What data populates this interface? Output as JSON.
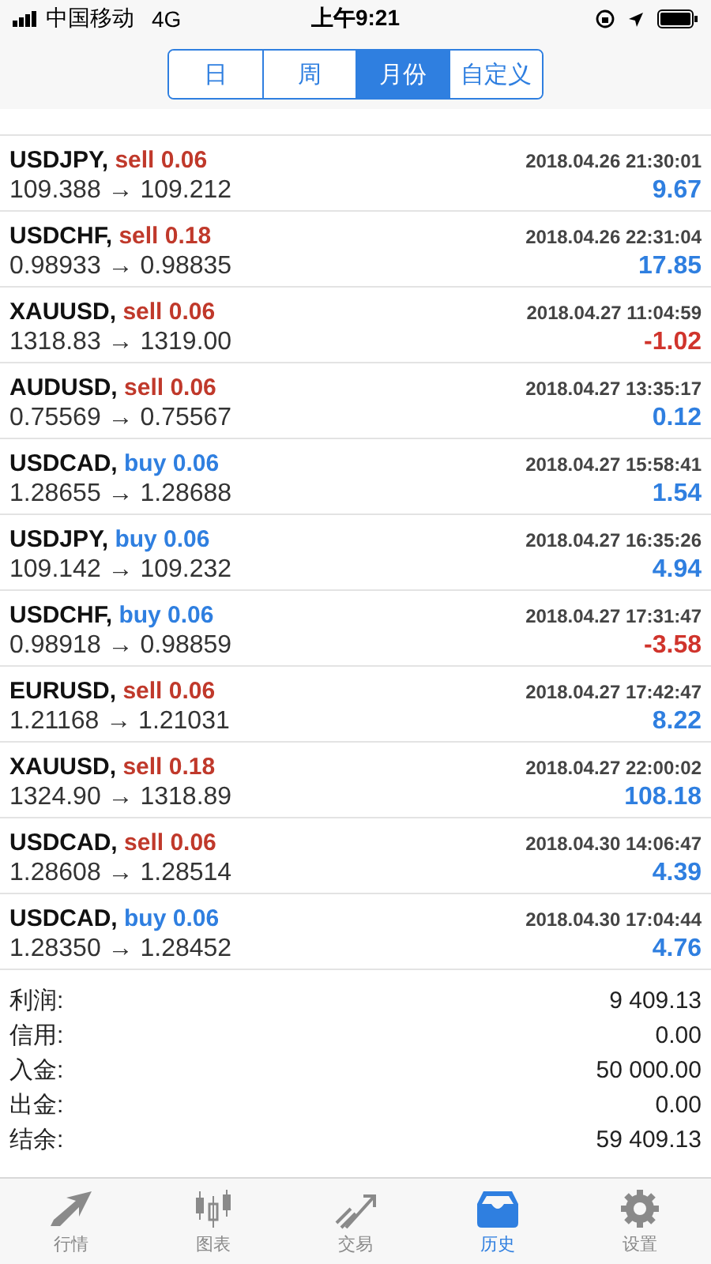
{
  "status_bar": {
    "carrier": "中国移动",
    "network": "4G",
    "time": "上午9:21"
  },
  "periods": [
    {
      "label": "日",
      "selected": false
    },
    {
      "label": "周",
      "selected": false
    },
    {
      "label": "月份",
      "selected": true
    },
    {
      "label": "自定义",
      "selected": false
    }
  ],
  "deals": [
    {
      "symbol": "USDJPY,",
      "kind": "sell",
      "order": "sell 0.06",
      "time": "2018.04.26 21:30:01",
      "prices": "109.388 → 109.212",
      "profit": "9.67",
      "loss": false
    },
    {
      "symbol": "USDCHF,",
      "kind": "sell",
      "order": "sell 0.18",
      "time": "2018.04.26 22:31:04",
      "prices": "0.98933 → 0.98835",
      "profit": "17.85",
      "loss": false
    },
    {
      "symbol": "XAUUSD,",
      "kind": "sell",
      "order": "sell 0.06",
      "time": "2018.04.27 11:04:59",
      "prices": "1318.83 → 1319.00",
      "profit": "-1.02",
      "loss": true
    },
    {
      "symbol": "AUDUSD,",
      "kind": "sell",
      "order": "sell 0.06",
      "time": "2018.04.27 13:35:17",
      "prices": "0.75569 → 0.75567",
      "profit": "0.12",
      "loss": false
    },
    {
      "symbol": "USDCAD,",
      "kind": "buy",
      "order": "buy 0.06",
      "time": "2018.04.27 15:58:41",
      "prices": "1.28655 → 1.28688",
      "profit": "1.54",
      "loss": false
    },
    {
      "symbol": "USDJPY,",
      "kind": "buy",
      "order": "buy 0.06",
      "time": "2018.04.27 16:35:26",
      "prices": "109.142 → 109.232",
      "profit": "4.94",
      "loss": false
    },
    {
      "symbol": "USDCHF,",
      "kind": "buy",
      "order": "buy 0.06",
      "time": "2018.04.27 17:31:47",
      "prices": "0.98918 → 0.98859",
      "profit": "-3.58",
      "loss": true
    },
    {
      "symbol": "EURUSD,",
      "kind": "sell",
      "order": "sell 0.06",
      "time": "2018.04.27 17:42:47",
      "prices": "1.21168 → 1.21031",
      "profit": "8.22",
      "loss": false
    },
    {
      "symbol": "XAUUSD,",
      "kind": "sell",
      "order": "sell 0.18",
      "time": "2018.04.27 22:00:02",
      "prices": "1324.90 → 1318.89",
      "profit": "108.18",
      "loss": false
    },
    {
      "symbol": "USDCAD,",
      "kind": "sell",
      "order": "sell 0.06",
      "time": "2018.04.30 14:06:47",
      "prices": "1.28608 → 1.28514",
      "profit": "4.39",
      "loss": false
    },
    {
      "symbol": "USDCAD,",
      "kind": "buy",
      "order": "buy 0.06",
      "time": "2018.04.30 17:04:44",
      "prices": "1.28350 → 1.28452",
      "profit": "4.76",
      "loss": false
    }
  ],
  "summary": [
    {
      "label": "利润:",
      "value": "9 409.13"
    },
    {
      "label": "信用:",
      "value": "0.00"
    },
    {
      "label": "入金:",
      "value": "50 000.00"
    },
    {
      "label": "出金:",
      "value": "0.00"
    },
    {
      "label": "结余:",
      "value": "59 409.13"
    }
  ],
  "tab_bar": [
    {
      "label": "行情",
      "kind": "quotes",
      "selected": false
    },
    {
      "label": "图表",
      "kind": "chart",
      "selected": false
    },
    {
      "label": "交易",
      "kind": "trade",
      "selected": false
    },
    {
      "label": "历史",
      "kind": "history",
      "selected": true
    },
    {
      "label": "设置",
      "kind": "settings",
      "selected": false
    }
  ]
}
